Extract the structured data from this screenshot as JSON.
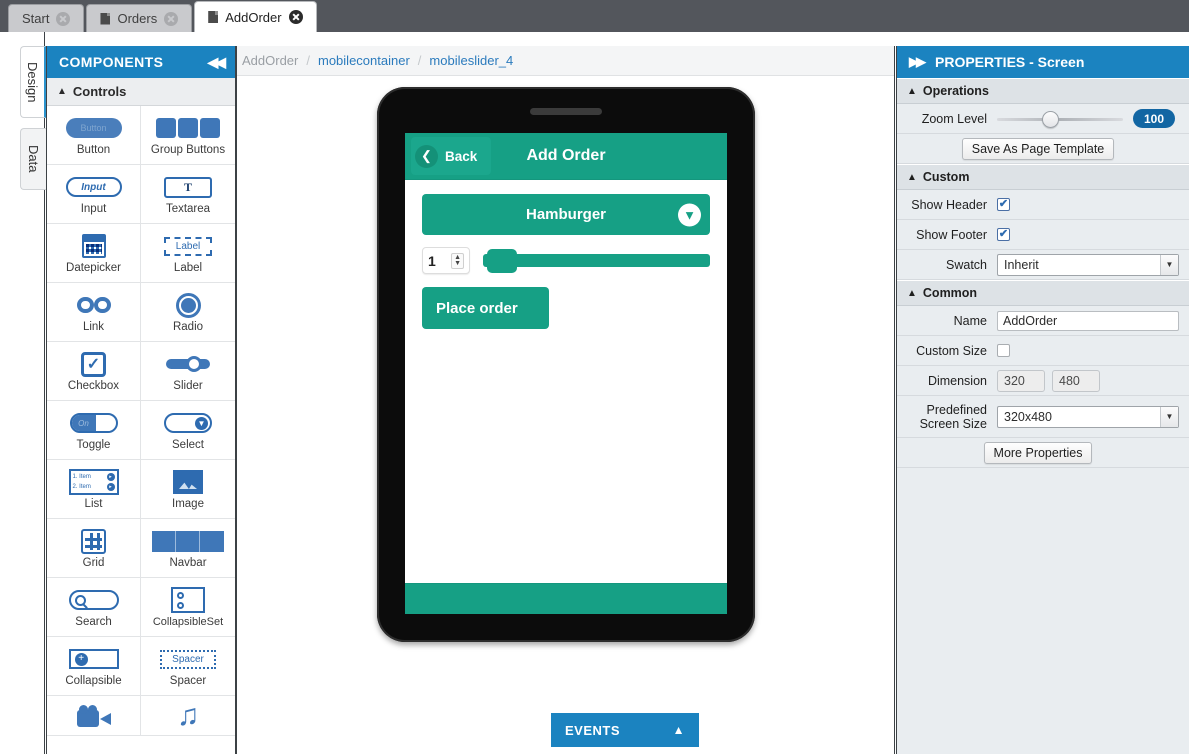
{
  "tabs": [
    {
      "label": "Start",
      "icon": null,
      "active": false,
      "close": "close-icon"
    },
    {
      "label": "Orders",
      "icon": "document-icon",
      "active": false,
      "close": "close-icon"
    },
    {
      "label": "AddOrder",
      "icon": "document-icon",
      "active": true,
      "close": "close-icon"
    }
  ],
  "rail": {
    "design": "Design",
    "data": "Data"
  },
  "components": {
    "header": "COMPONENTS",
    "collapse_icon": "◀◀",
    "group": {
      "label": "Controls",
      "caret": "▲"
    },
    "items": [
      {
        "label": "Button",
        "icon": "button-icon",
        "inner": "Button"
      },
      {
        "label": "Group Buttons",
        "icon": "group-buttons-icon"
      },
      {
        "label": "Input",
        "icon": "input-icon",
        "inner": "Input"
      },
      {
        "label": "Textarea",
        "icon": "textarea-icon",
        "inner": "T"
      },
      {
        "label": "Datepicker",
        "icon": "datepicker-icon"
      },
      {
        "label": "Label",
        "icon": "label-icon",
        "inner": "Label"
      },
      {
        "label": "Link",
        "icon": "link-icon"
      },
      {
        "label": "Radio",
        "icon": "radio-icon"
      },
      {
        "label": "Checkbox",
        "icon": "checkbox-icon"
      },
      {
        "label": "Slider",
        "icon": "slider-icon"
      },
      {
        "label": "Toggle",
        "icon": "toggle-icon",
        "inner": "On"
      },
      {
        "label": "Select",
        "icon": "select-icon"
      },
      {
        "label": "List",
        "icon": "list-icon",
        "row1": "1. Item",
        "row2": "2. Item"
      },
      {
        "label": "Image",
        "icon": "image-icon"
      },
      {
        "label": "Grid",
        "icon": "grid-icon"
      },
      {
        "label": "Navbar",
        "icon": "navbar-icon"
      },
      {
        "label": "Search",
        "icon": "search-icon"
      },
      {
        "label": "CollapsibleSet",
        "icon": "collapsible-set-icon"
      },
      {
        "label": "Collapsible",
        "icon": "collapsible-icon"
      },
      {
        "label": "Spacer",
        "icon": "spacer-icon",
        "inner": "Spacer"
      },
      {
        "label": "Video",
        "icon": "video-icon"
      },
      {
        "label": "Audio",
        "icon": "audio-icon"
      }
    ]
  },
  "breadcrumb": {
    "current": "AddOrder",
    "sep": "/",
    "link1": "mobilecontainer",
    "link2": "mobileslider_4"
  },
  "mobile": {
    "back_label": "Back",
    "back_icon": "❮",
    "title": "Add Order",
    "select_label": "Hamburger",
    "select_arrow_icon": "⬇",
    "spinner_value": "1",
    "spinner_up": "▲",
    "spinner_down": "▼",
    "place_order_label": "Place order"
  },
  "events": {
    "label": "EVENTS",
    "arrow_icon": "▲"
  },
  "properties": {
    "header": "PROPERTIES - Screen",
    "expand_icon": "▶▶",
    "groups": {
      "operations": "Operations",
      "custom": "Custom",
      "common": "Common"
    },
    "zoom": {
      "label": "Zoom Level",
      "value": "100"
    },
    "save_template_label": "Save As Page Template",
    "show_header": {
      "label": "Show Header",
      "checked": true,
      "check": "✔"
    },
    "show_footer": {
      "label": "Show Footer",
      "checked": true,
      "check": "✔"
    },
    "swatch": {
      "label": "Swatch",
      "value": "Inherit",
      "arrow": "▼"
    },
    "name": {
      "label": "Name",
      "value": "AddOrder"
    },
    "custom_size": {
      "label": "Custom Size",
      "checked": false
    },
    "dimension": {
      "label": "Dimension",
      "width": "320",
      "height": "480"
    },
    "predefined": {
      "label_line1": "Predefined",
      "label_line2": "Screen Size",
      "value": "320x480",
      "arrow": "▼"
    },
    "more_properties_label": "More Properties"
  },
  "colors": {
    "header_blue": "#1b83c0",
    "teal": "#16a085",
    "palette_blue": "#3f77b8",
    "panel_bg": "#e9edf0",
    "tabstrip": "#53565c"
  }
}
